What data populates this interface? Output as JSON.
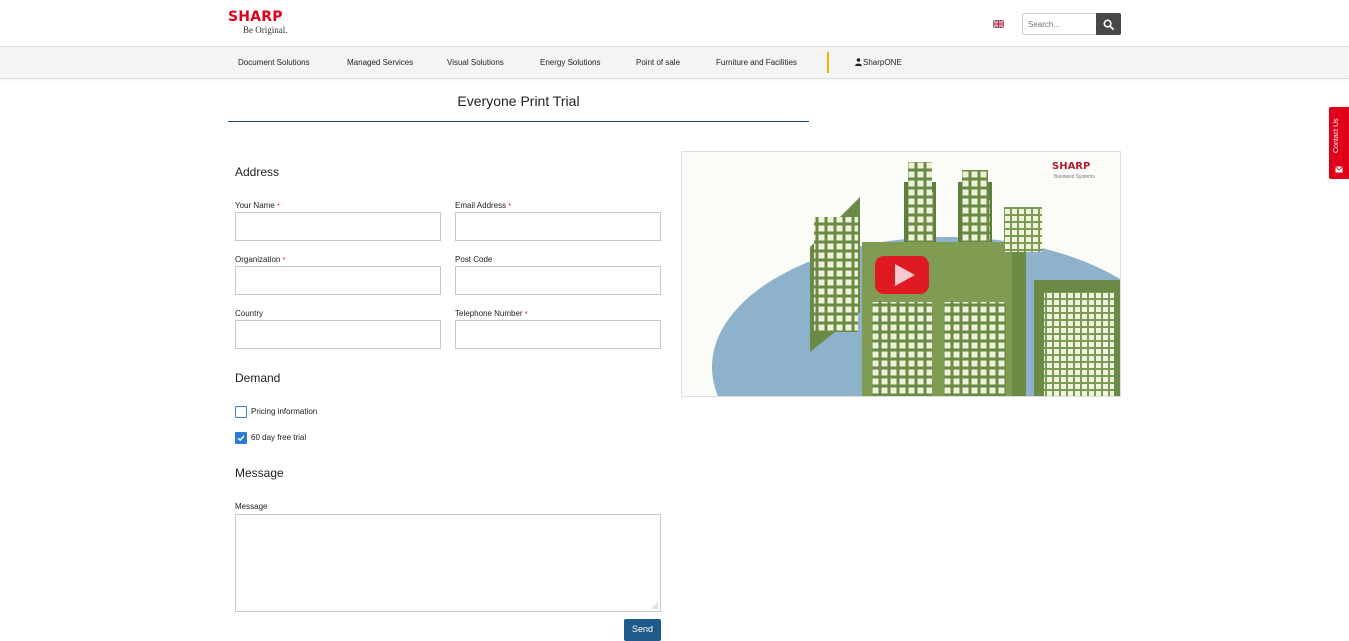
{
  "header": {
    "brand": "SHARP",
    "tagline": "Be Original.",
    "search": {
      "placeholder": "Search..."
    }
  },
  "nav": {
    "items": [
      {
        "label": "Document Solutions"
      },
      {
        "label": "Managed Services"
      },
      {
        "label": "Visual Solutions"
      },
      {
        "label": "Energy Solutions"
      },
      {
        "label": "Point of sale"
      },
      {
        "label": "Furniture and Facilities"
      }
    ],
    "account_label": "SharpONE"
  },
  "page": {
    "title": "Everyone Print Trial"
  },
  "form": {
    "address_heading": "Address",
    "fields": {
      "name": {
        "label": "Your Name",
        "required": "*"
      },
      "email": {
        "label": "Email Address",
        "required": "*"
      },
      "organization": {
        "label": "Organization",
        "required": "*"
      },
      "postcode": {
        "label": "Post Code"
      },
      "country": {
        "label": "Country"
      },
      "phone": {
        "label": "Telephone Number",
        "required": "*"
      }
    },
    "demand_heading": "Demand",
    "demand_options": [
      {
        "label": "Pricing information",
        "checked": false
      },
      {
        "label": "60 day free trial",
        "checked": true
      }
    ],
    "message_heading": "Message",
    "message_label": "Message",
    "send_label": "Send"
  },
  "video": {
    "brand": "SHARP",
    "subtitle": "Business Systems"
  },
  "side_tab": {
    "label": "Contact Us"
  },
  "colors": {
    "brand_red": "#e0001a",
    "nav_separator": "#f2b100",
    "title_rule": "#1f4e79",
    "checkbox_blue": "#2b7bd4",
    "send_button": "#1f5a8a",
    "play_button": "#e01a22"
  }
}
